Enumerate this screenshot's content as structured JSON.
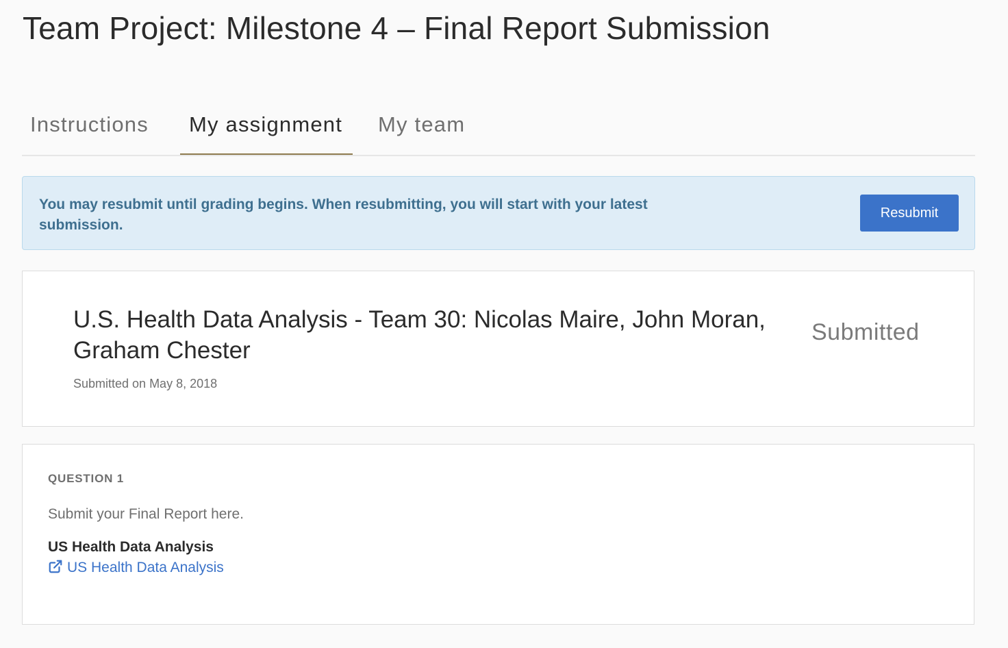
{
  "page": {
    "title": "Team Project: Milestone 4 – Final Report Submission"
  },
  "tabs": [
    {
      "label": "Instructions",
      "active": false
    },
    {
      "label": "My assignment",
      "active": true
    },
    {
      "label": "My team",
      "active": false
    }
  ],
  "notice": {
    "text": "You may resubmit until grading begins. When resubmitting, you will start with your latest submission.",
    "button_label": "Resubmit"
  },
  "submission": {
    "title": "U.S. Health Data Analysis - Team 30: Nicolas Maire, John Moran, Graham Chester",
    "date": "Submitted on May 8, 2018",
    "status": "Submitted"
  },
  "question": {
    "label": "QUESTION 1",
    "prompt": "Submit your Final Report here.",
    "answer_title": "US Health Data Analysis",
    "link_text": "US Health Data Analysis",
    "link_icon": "external-link-icon"
  },
  "colors": {
    "accent": "#3b73c9",
    "tab_underline": "#8f7b4e",
    "notice_background": "#dfedf7",
    "notice_text": "#3e6f8f"
  }
}
